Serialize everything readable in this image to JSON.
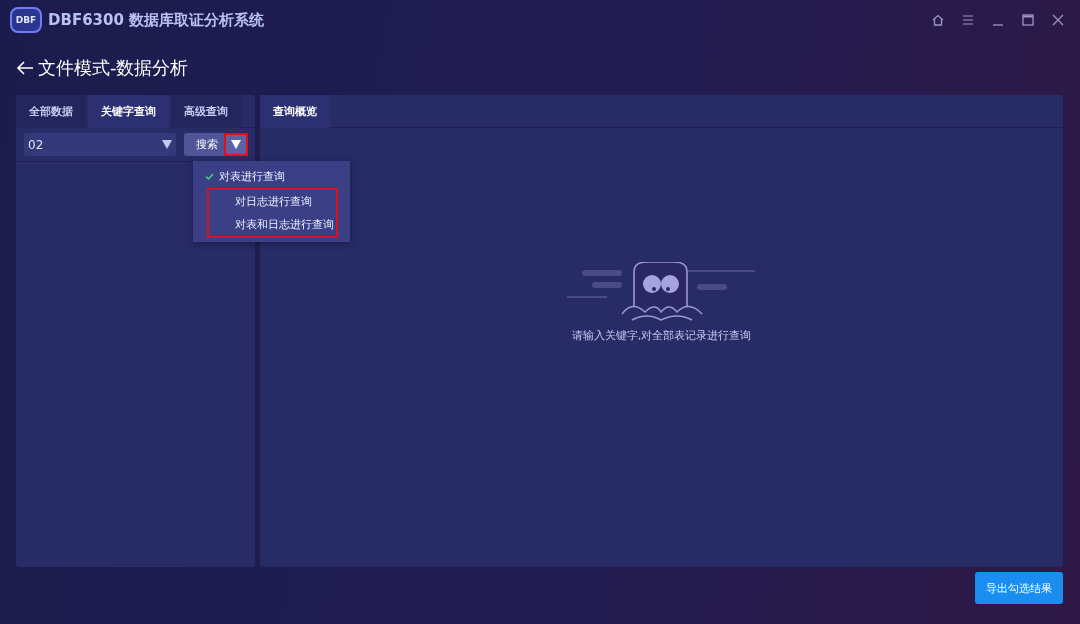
{
  "app": {
    "logo": "DBF",
    "title": "DBF6300 数据库取证分析系统"
  },
  "page": {
    "title": "文件模式-数据分析"
  },
  "left_tabs": [
    {
      "label": "全部数据",
      "selected": false
    },
    {
      "label": "关键字查询",
      "selected": true
    },
    {
      "label": "高级查询",
      "selected": false
    }
  ],
  "keyword_field": {
    "value": "02"
  },
  "search_button": {
    "label": "搜索",
    "caret_highlighted": true
  },
  "search_menu": [
    {
      "label": "对表进行查询",
      "checked": true,
      "highlighted": false
    },
    {
      "label": "对日志进行查询",
      "checked": false,
      "highlighted": true
    },
    {
      "label": "对表和日志进行查询",
      "checked": false,
      "highlighted": true
    }
  ],
  "right_tabs": [
    {
      "label": "查询概览",
      "selected": true
    }
  ],
  "empty_state": {
    "message": "请输入关键字,对全部表记录进行查询"
  },
  "export_button": {
    "label": "导出勾选结果"
  }
}
